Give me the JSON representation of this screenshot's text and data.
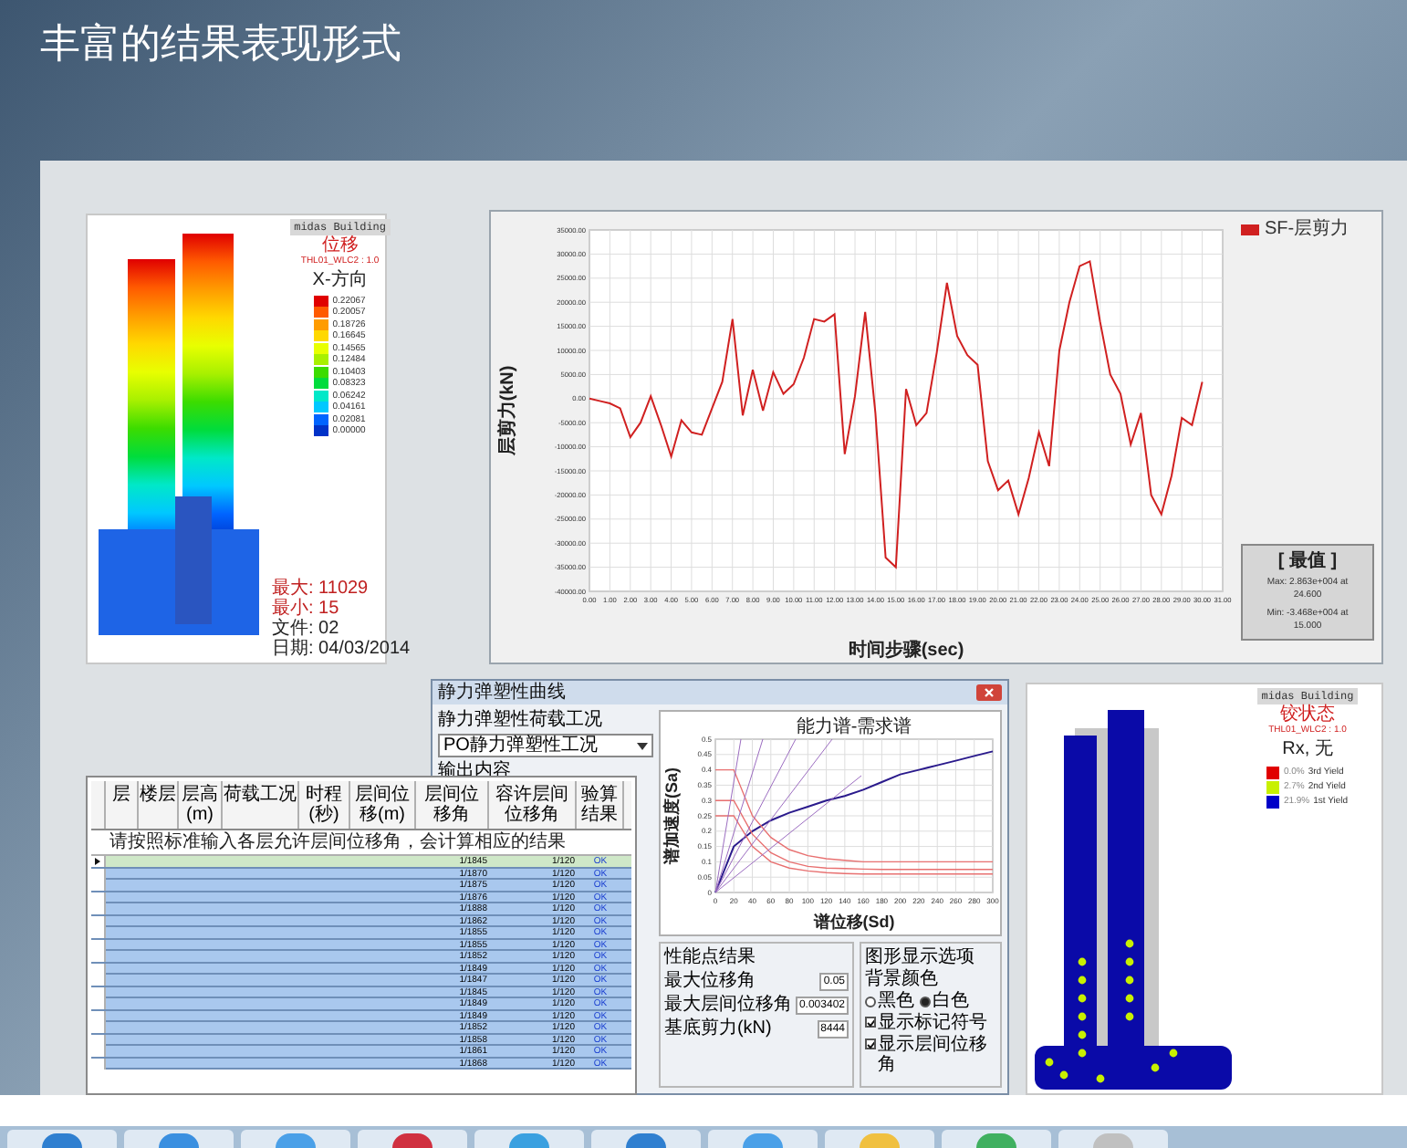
{
  "title": "丰富的结果表现形式",
  "contour_view": {
    "brand": "midas Building",
    "result": "位移",
    "load_case": "THL01_WLC2 : 1.0",
    "component": "X-方向",
    "legend": [
      {
        "value": "0.22067",
        "color": "#e00000"
      },
      {
        "value": "0.20057",
        "color": "#ff5a00"
      },
      {
        "value": "0.18726",
        "color": "#ff9c00"
      },
      {
        "value": "0.16645",
        "color": "#ffd800"
      },
      {
        "value": "0.14565",
        "color": "#e8ff00"
      },
      {
        "value": "0.12484",
        "color": "#a8f000"
      },
      {
        "value": "0.10403",
        "color": "#3cdc00"
      },
      {
        "value": "0.08323",
        "color": "#00dc3c"
      },
      {
        "value": "0.06242",
        "color": "#00e8c8"
      },
      {
        "value": "0.04161",
        "color": "#00c8ff"
      },
      {
        "value": "0.02081",
        "color": "#0064ff"
      },
      {
        "value": "0.00000",
        "color": "#0032c8"
      }
    ],
    "footer": [
      "最大: 11029",
      "最小: 15",
      "文件: 02",
      "日期: 04/03/2014"
    ]
  },
  "time_history": {
    "summary_title": "[ 最值 ]",
    "summary": [
      "Max: 2.863e+004 at 24.600",
      "Min: -3.468e+004 at 15.000"
    ],
    "chart_data": {
      "type": "line",
      "grid": true,
      "xlabel": "时间步骤(sec)",
      "ylabel": "层剪力(kN)",
      "x": [
        0,
        0.5,
        1,
        1.5,
        2,
        2.5,
        3,
        3.5,
        4,
        4.5,
        5,
        5.5,
        6,
        6.5,
        7,
        7.5,
        8,
        8.5,
        9,
        9.5,
        10,
        10.5,
        11,
        11.5,
        12,
        12.5,
        13,
        13.5,
        14,
        14.5,
        15,
        15.5,
        16,
        16.5,
        17,
        17.5,
        18,
        18.5,
        19,
        19.5,
        20,
        20.5,
        21,
        21.5,
        22,
        22.5,
        23,
        23.5,
        24,
        24.5,
        25,
        25.5,
        26,
        26.5,
        27,
        27.5,
        28,
        28.5,
        29,
        29.5,
        30
      ],
      "series": [
        {
          "name": "SF-层剪力",
          "color": "#d02020",
          "values": [
            0,
            -500,
            -1000,
            -2000,
            -8000,
            -5000,
            500,
            -5500,
            -12000,
            -4500,
            -7000,
            -7500,
            -2000,
            3500,
            16500,
            -3500,
            6000,
            -2500,
            5500,
            1000,
            3000,
            8500,
            16500,
            16000,
            17500,
            -11500,
            500,
            18000,
            -3000,
            -33000,
            -35000,
            2000,
            -5500,
            -3000,
            9500,
            24000,
            13000,
            9000,
            7000,
            -13000,
            -19000,
            -17000,
            -24000,
            -16500,
            -7000,
            -14000,
            10000,
            20000,
            27500,
            28500,
            16000,
            5000,
            1000,
            -9500,
            -3000,
            -20000,
            -24000,
            -16000,
            -4000,
            -5500,
            3500
          ]
        }
      ],
      "xlim": [
        0,
        31
      ],
      "ylim": [
        -40000,
        35000
      ],
      "xticks": [
        {
          "value": 0,
          "label": "0.00"
        },
        {
          "value": 1,
          "label": "1.00"
        },
        {
          "value": 2,
          "label": "2.00"
        },
        {
          "value": 3,
          "label": "3.00"
        },
        {
          "value": 4,
          "label": "4.00"
        },
        {
          "value": 5,
          "label": "5.00"
        },
        {
          "value": 6,
          "label": "6.00"
        },
        {
          "value": 7,
          "label": "7.00"
        },
        {
          "value": 8,
          "label": "8.00"
        },
        {
          "value": 9,
          "label": "9.00"
        },
        {
          "value": 10,
          "label": "10.00"
        },
        {
          "value": 11,
          "label": "11.00"
        },
        {
          "value": 12,
          "label": "12.00"
        },
        {
          "value": 13,
          "label": "13.00"
        },
        {
          "value": 14,
          "label": "14.00"
        },
        {
          "value": 15,
          "label": "15.00"
        },
        {
          "value": 16,
          "label": "16.00"
        },
        {
          "value": 17,
          "label": "17.00"
        },
        {
          "value": 18,
          "label": "18.00"
        },
        {
          "value": 19,
          "label": "19.00"
        },
        {
          "value": 20,
          "label": "20.00"
        },
        {
          "value": 21,
          "label": "21.00"
        },
        {
          "value": 22,
          "label": "22.00"
        },
        {
          "value": 23,
          "label": "23.00"
        },
        {
          "value": 24,
          "label": "24.00"
        },
        {
          "value": 25,
          "label": "25.00"
        },
        {
          "value": 26,
          "label": "26.00"
        },
        {
          "value": 27,
          "label": "27.00"
        },
        {
          "value": 28,
          "label": "28.00"
        },
        {
          "value": 29,
          "label": "29.00"
        },
        {
          "value": 30,
          "label": "30.00"
        },
        {
          "value": 31,
          "label": "31.00"
        }
      ],
      "yticks": [
        {
          "value": 35000,
          "label": "35000.00"
        },
        {
          "value": 30000,
          "label": "30000.00"
        },
        {
          "value": 25000,
          "label": "25000.00"
        },
        {
          "value": 20000,
          "label": "20000.00"
        },
        {
          "value": 15000,
          "label": "15000.00"
        },
        {
          "value": 10000,
          "label": "10000.00"
        },
        {
          "value": 5000,
          "label": "5000.00"
        },
        {
          "value": 0,
          "label": "0.00"
        },
        {
          "value": -5000,
          "label": "-5000.00"
        },
        {
          "value": -10000,
          "label": "-10000.00"
        },
        {
          "value": -15000,
          "label": "-15000.00"
        },
        {
          "value": -20000,
          "label": "-20000.00"
        },
        {
          "value": -25000,
          "label": "-25000.00"
        },
        {
          "value": -30000,
          "label": "-30000.00"
        },
        {
          "value": -35000,
          "label": "-35000.00"
        },
        {
          "value": -40000,
          "label": "-40000.00"
        }
      ]
    }
  },
  "pushover_dialog": {
    "title": "静力弹塑性曲线",
    "case_label": "静力弹塑性荷载工况",
    "case_value": "PO静力弹塑性工况",
    "output_group": "输出内容",
    "chart_data": {
      "type": "line",
      "grid": true,
      "title": "能力谱-需求谱",
      "xlabel": "谱位移(Sd)",
      "ylabel": "谱加速度(Sa)",
      "x": [
        0,
        20,
        40,
        60,
        80,
        100,
        120,
        140,
        160,
        180,
        200,
        220,
        240,
        260,
        280,
        300
      ],
      "series": [
        {
          "color": "#2a1a8c",
          "values": [
            0,
            0.15,
            0.2,
            0.235,
            0.26,
            0.28,
            0.3,
            0.315,
            0.335,
            0.36,
            0.385,
            0.4,
            0.415,
            0.43,
            0.445,
            0.46
          ]
        },
        {
          "color": "#e87070",
          "values": [
            0.4,
            0.4,
            0.25,
            0.18,
            0.14,
            0.12,
            0.11,
            0.105,
            0.1,
            0.1,
            0.1,
            0.1,
            0.1,
            0.1,
            0.1,
            0.1
          ]
        },
        {
          "color": "#e87070",
          "values": [
            0.3,
            0.3,
            0.19,
            0.13,
            0.1,
            0.085,
            0.08,
            0.078,
            0.076,
            0.075,
            0.075,
            0.075,
            0.075,
            0.075,
            0.075,
            0.075
          ]
        },
        {
          "color": "#e87070",
          "values": [
            0.25,
            0.25,
            0.15,
            0.1,
            0.08,
            0.07,
            0.065,
            0.062,
            0.06,
            0.06,
            0.06,
            0.06,
            0.06,
            0.06,
            0.06,
            0.06
          ]
        }
      ],
      "xlim": [
        0,
        300
      ],
      "ylim": [
        0,
        0.5
      ],
      "xticks": [
        0,
        20,
        40,
        60,
        80,
        100,
        120,
        140,
        160,
        180,
        200,
        220,
        240,
        260,
        280,
        300
      ],
      "yticks": [
        {
          "value": 0,
          "label": "0"
        },
        {
          "value": 0.05,
          "label": "0.05"
        },
        {
          "value": 0.1,
          "label": "0.1"
        },
        {
          "value": 0.15,
          "label": "0.15"
        },
        {
          "value": 0.2,
          "label": "0.2"
        },
        {
          "value": 0.25,
          "label": "0.25"
        },
        {
          "value": 0.3,
          "label": "0.3"
        },
        {
          "value": 0.35,
          "label": "0.35"
        },
        {
          "value": 0.4,
          "label": "0.4"
        },
        {
          "value": 0.45,
          "label": "0.45"
        },
        {
          "value": 0.5,
          "label": "0.5"
        }
      ]
    },
    "results_title": "性能点结果",
    "results": [
      {
        "label": "最大位移角",
        "value": "0.05"
      },
      {
        "label": "最大层间位移角",
        "value": "0.003402"
      },
      {
        "label": "基底剪力(kN)",
        "value": "8444"
      }
    ],
    "display_title": "图形显示选项",
    "background_label": "背景颜色",
    "background_options": [
      {
        "label": "黑色",
        "selected": false
      },
      {
        "label": "白色",
        "selected": true
      }
    ],
    "checks": [
      {
        "label": "显示标记符号",
        "checked": true
      },
      {
        "label": "显示层间位移角",
        "checked": true
      }
    ]
  },
  "drift_table": {
    "columns": [
      "层",
      "楼层",
      "层高(m)",
      "荷载工况",
      "时程(秒)",
      "层间位移(m)",
      "层间位移角",
      "容许层间位移角",
      "验算结果"
    ],
    "note": "请按照标准输入各层允许层间位移角，会计算相应的结果",
    "rows": [
      {
        "ratio": "1/1845",
        "allowable": "1/120",
        "result": "OK",
        "selected": true
      },
      {
        "ratio": "1/1870",
        "allowable": "1/120",
        "result": "OK",
        "selected": false
      },
      {
        "ratio": "1/1875",
        "allowable": "1/120",
        "result": "OK",
        "selected": false
      },
      {
        "ratio": "1/1876",
        "allowable": "1/120",
        "result": "OK",
        "selected": false
      },
      {
        "ratio": "1/1888",
        "allowable": "1/120",
        "result": "OK",
        "selected": false
      },
      {
        "ratio": "1/1862",
        "allowable": "1/120",
        "result": "OK",
        "selected": false
      },
      {
        "ratio": "1/1855",
        "allowable": "1/120",
        "result": "OK",
        "selected": false
      },
      {
        "ratio": "1/1855",
        "allowable": "1/120",
        "result": "OK",
        "selected": false
      },
      {
        "ratio": "1/1852",
        "allowable": "1/120",
        "result": "OK",
        "selected": false
      },
      {
        "ratio": "1/1849",
        "allowable": "1/120",
        "result": "OK",
        "selected": false
      },
      {
        "ratio": "1/1847",
        "allowable": "1/120",
        "result": "OK",
        "selected": false
      },
      {
        "ratio": "1/1845",
        "allowable": "1/120",
        "result": "OK",
        "selected": false
      },
      {
        "ratio": "1/1849",
        "allowable": "1/120",
        "result": "OK",
        "selected": false
      },
      {
        "ratio": "1/1849",
        "allowable": "1/120",
        "result": "OK",
        "selected": false
      },
      {
        "ratio": "1/1852",
        "allowable": "1/120",
        "result": "OK",
        "selected": false
      },
      {
        "ratio": "1/1858",
        "allowable": "1/120",
        "result": "OK",
        "selected": false
      },
      {
        "ratio": "1/1861",
        "allowable": "1/120",
        "result": "OK",
        "selected": false
      },
      {
        "ratio": "1/1868",
        "allowable": "1/120",
        "result": "OK",
        "selected": false
      }
    ]
  },
  "hinge_view": {
    "brand": "midas Building",
    "result": "铰状态",
    "load_case": "THL01_WLC2 : 1.0",
    "component": "Rx, 无",
    "legend": [
      {
        "label": "3rd Yield",
        "percent": "0.0%",
        "color": "#e00000"
      },
      {
        "label": "2nd Yield",
        "percent": "2.7%",
        "color": "#c8f000"
      },
      {
        "label": "1st Yield",
        "percent": "21.9%",
        "color": "#0000c8"
      }
    ]
  }
}
